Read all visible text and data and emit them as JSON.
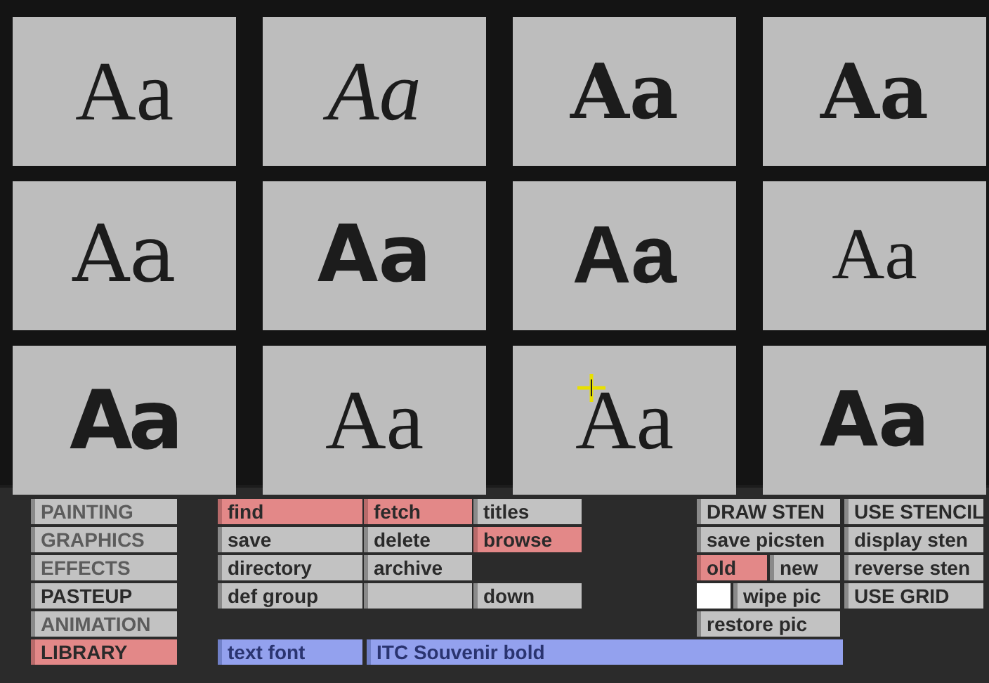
{
  "tiles": [
    {
      "sample": "Aa",
      "kind": "serif",
      "cursor": false
    },
    {
      "sample": "Aa",
      "kind": "italic",
      "cursor": false
    },
    {
      "sample": "Aa",
      "kind": "slab",
      "cursor": false
    },
    {
      "sample": "Aa",
      "kind": "slab",
      "cursor": false
    },
    {
      "sample": "Aa",
      "kind": "soft",
      "cursor": false
    },
    {
      "sample": "Aa",
      "kind": "heavy",
      "cursor": false
    },
    {
      "sample": "Aa",
      "kind": "grotesque",
      "cursor": false
    },
    {
      "sample": "Aa",
      "kind": "light",
      "cursor": false
    },
    {
      "sample": "Aa",
      "kind": "black",
      "cursor": false
    },
    {
      "sample": "Aa",
      "kind": "serif",
      "cursor": false
    },
    {
      "sample": "Aa",
      "kind": "serif",
      "cursor": true
    },
    {
      "sample": "Aa",
      "kind": "rounded",
      "cursor": false
    }
  ],
  "modes": [
    {
      "label": "PAINTING",
      "selected": false,
      "dim": true
    },
    {
      "label": "GRAPHICS",
      "selected": false,
      "dim": true
    },
    {
      "label": "EFFECTS",
      "selected": false,
      "dim": true
    },
    {
      "label": "PASTEUP",
      "selected": false,
      "dim": false
    },
    {
      "label": "ANIMATION",
      "selected": false,
      "dim": true
    },
    {
      "label": "LIBRARY",
      "selected": true,
      "dim": false
    }
  ],
  "library": [
    {
      "kind": "button",
      "label": "find",
      "selected": true
    },
    {
      "kind": "button",
      "label": "fetch",
      "selected": true
    },
    {
      "kind": "button",
      "label": "titles",
      "selected": false
    },
    {
      "kind": "button",
      "label": "save",
      "selected": false
    },
    {
      "kind": "button",
      "label": "delete",
      "selected": false
    },
    {
      "kind": "button",
      "label": "browse",
      "selected": true
    },
    {
      "kind": "button",
      "label": "directory",
      "selected": false
    },
    {
      "kind": "button",
      "label": "archive",
      "selected": false
    },
    {
      "kind": "gap"
    },
    {
      "kind": "button",
      "label": "def group",
      "selected": false
    },
    {
      "kind": "blank"
    },
    {
      "kind": "button",
      "label": "down",
      "selected": false
    }
  ],
  "text_font": {
    "label": "text font",
    "value": "ITC Souvenir bold"
  },
  "stencil": {
    "column_1": [
      [
        {
          "kind": "button",
          "label": "DRAW STEN",
          "selected": false
        }
      ],
      [
        {
          "kind": "button",
          "label": "save picsten",
          "selected": false
        }
      ],
      [
        {
          "kind": "button",
          "label": "old",
          "selected": true
        },
        {
          "kind": "button",
          "label": "new",
          "selected": false
        }
      ],
      [
        {
          "kind": "swatch",
          "color": "#ffffff"
        },
        {
          "kind": "button",
          "label": "wipe pic",
          "selected": false
        }
      ],
      [
        {
          "kind": "button",
          "label": "restore pic",
          "selected": false
        }
      ]
    ],
    "column_2": [
      {
        "label": "USE STENCIL",
        "selected": false
      },
      {
        "label": "display sten",
        "selected": false
      },
      {
        "label": "reverse sten",
        "selected": false
      },
      {
        "label": "USE GRID",
        "selected": false
      }
    ]
  }
}
